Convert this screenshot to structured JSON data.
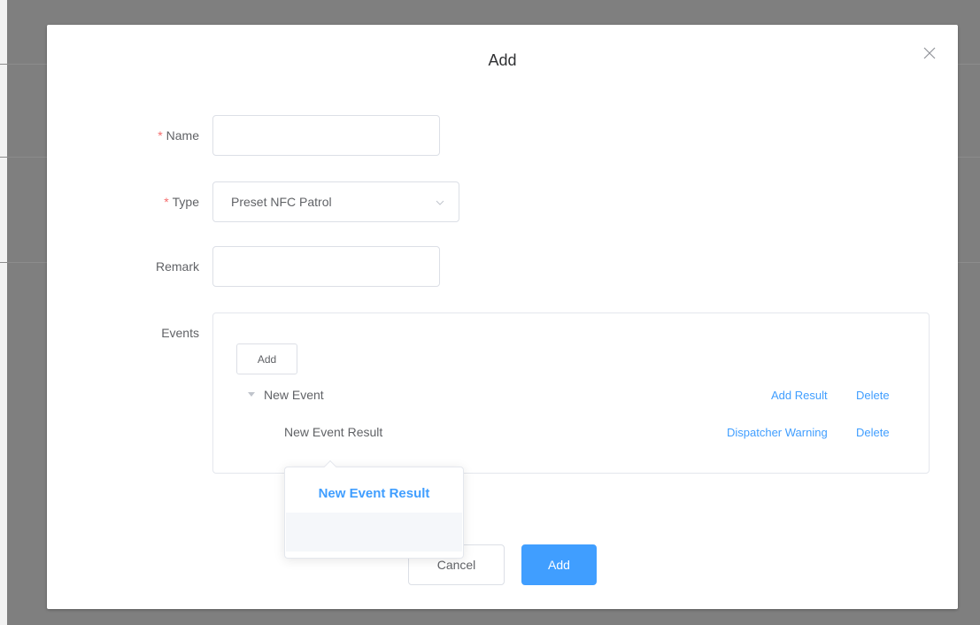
{
  "dialog": {
    "title": "Add",
    "close_icon": "close-icon"
  },
  "form": {
    "required_mark": "*",
    "name": {
      "label": "Name",
      "value": "",
      "required": true
    },
    "type": {
      "label": "Type",
      "value": "Preset NFC Patrol",
      "required": true,
      "arrow_icon": "chevron-down-icon"
    },
    "remark": {
      "label": "Remark",
      "value": "",
      "required": false
    },
    "events": {
      "label": "Events",
      "add_label": "Add",
      "tree": {
        "node_label": "New Event",
        "node_actions": [
          "Add Result",
          "Delete"
        ],
        "child_label": "New Event Result",
        "child_actions": [
          "Dispatcher Warning",
          "Delete"
        ]
      }
    }
  },
  "popover": {
    "items": [
      "New Event Result",
      ""
    ]
  },
  "footer": {
    "cancel_label": "Cancel",
    "confirm_label": "Add"
  },
  "colors": {
    "primary": "#409eff",
    "required": "#f56c6c",
    "text": "#606266",
    "overlay": "#7f7f7f"
  }
}
